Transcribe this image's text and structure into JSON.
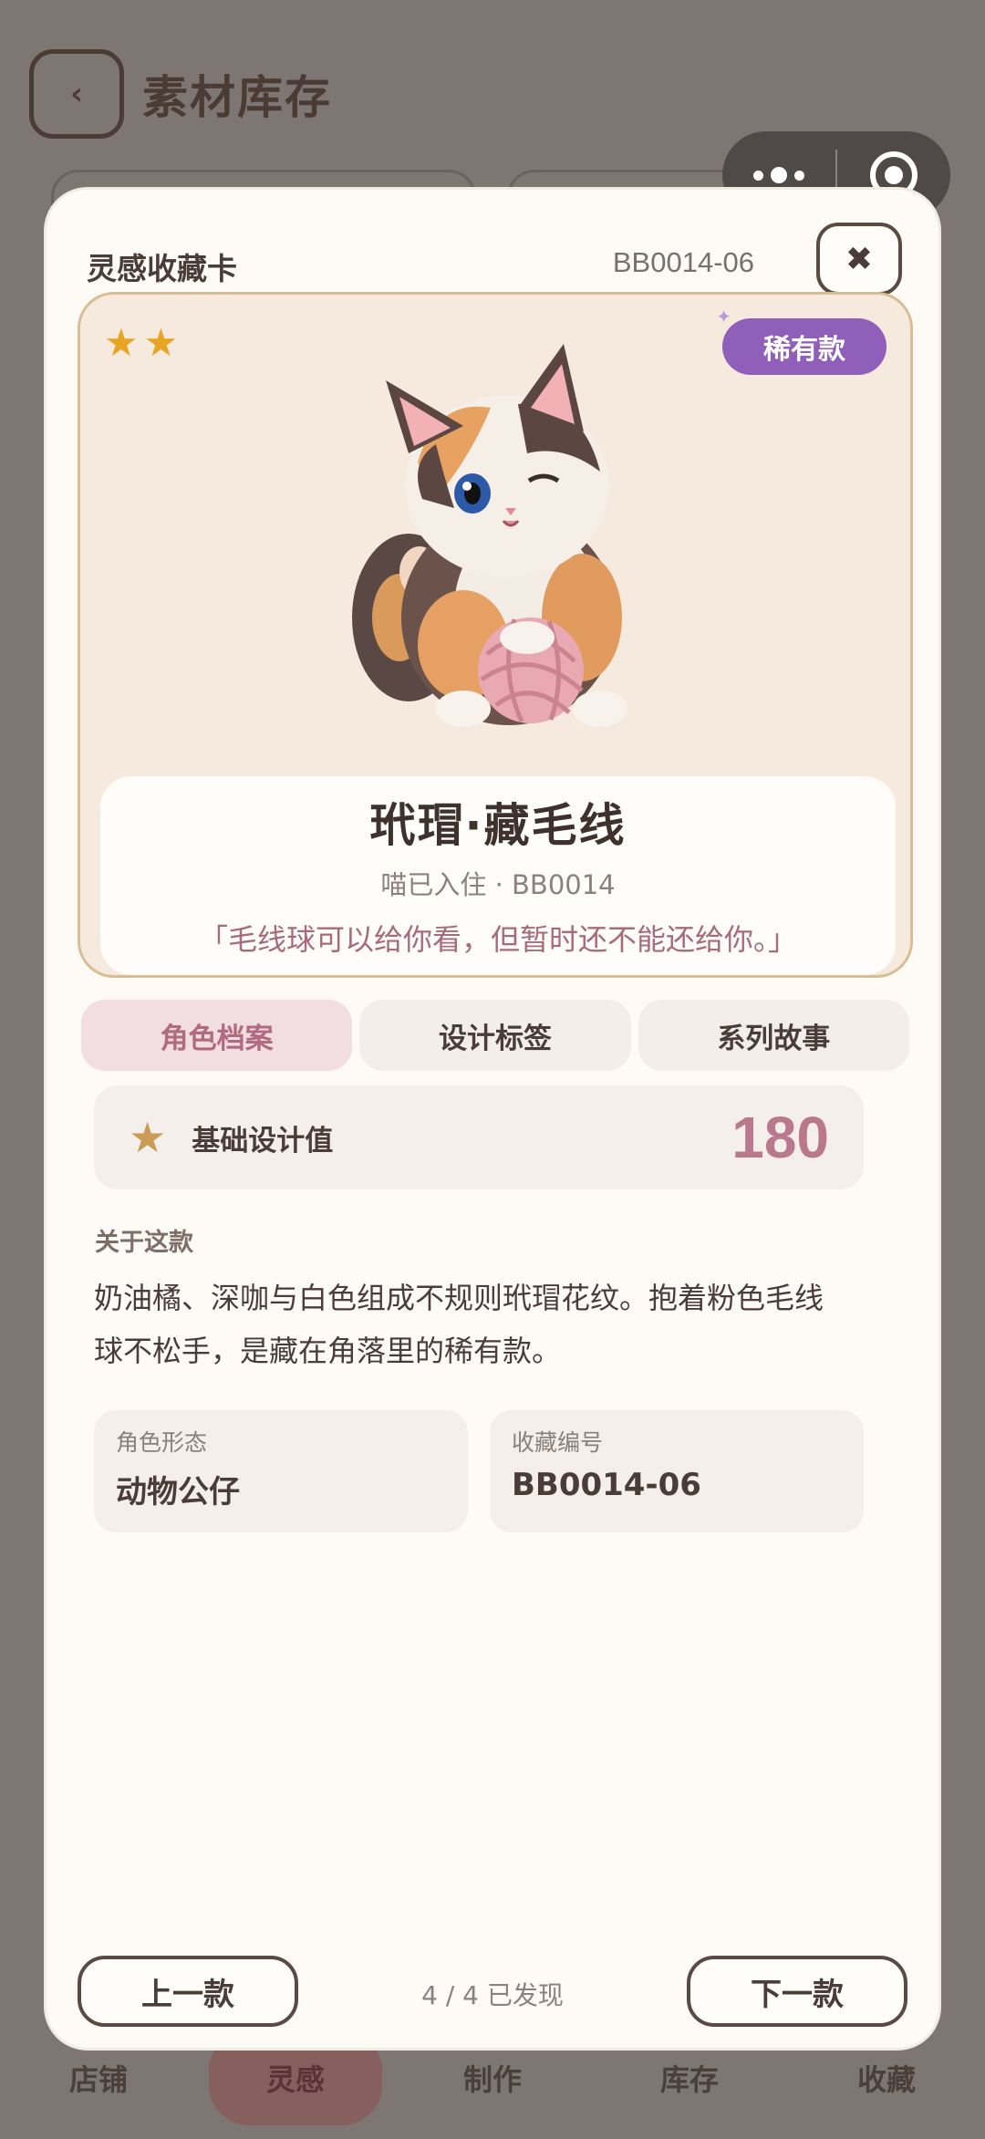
{
  "background_page": {
    "title": "素材库存",
    "back_label": "‹"
  },
  "tabbar": {
    "items": [
      {
        "label": "店铺"
      },
      {
        "label": "灵感"
      },
      {
        "label": "制作"
      },
      {
        "label": "库存"
      },
      {
        "label": "收藏"
      }
    ],
    "active_index": 1
  },
  "modal": {
    "title": "灵感收藏卡",
    "code": "BB0014-06",
    "close_label": "✖",
    "hero": {
      "star_count": 2,
      "stars": [
        "★",
        "★"
      ],
      "rarity_badge": "稀有款",
      "sparkle": "✦",
      "name": "玳瑁·藏毛线",
      "subtitle": "喵已入住 · BB0014",
      "quote": "「毛线球可以给你看，但暂时还不能还给你。」"
    },
    "tabs": [
      {
        "label": "角色档案",
        "active": true
      },
      {
        "label": "设计标签",
        "active": false
      },
      {
        "label": "系列故事",
        "active": false
      }
    ],
    "design_value": {
      "icon": "★",
      "label": "基础设计值",
      "value": "180"
    },
    "about": {
      "title": "关于这款",
      "text": "奶油橘、深咖与白色组成不规则玳瑁花纹。抱着粉色毛线球不松手，是藏在角落里的稀有款。"
    },
    "attributes": [
      {
        "key": "角色形态",
        "value": "动物公仔"
      },
      {
        "key": "收藏编号",
        "value": "BB0014-06"
      }
    ],
    "footer": {
      "prev_label": "上一款",
      "next_label": "下一款",
      "progress": "4 / 4 已发现"
    }
  },
  "colors": {
    "overlay": "#7d7673",
    "accent_pink": "#b9788e",
    "rare_purple": "#8f5fb9",
    "star_gold": "#e8a524"
  }
}
